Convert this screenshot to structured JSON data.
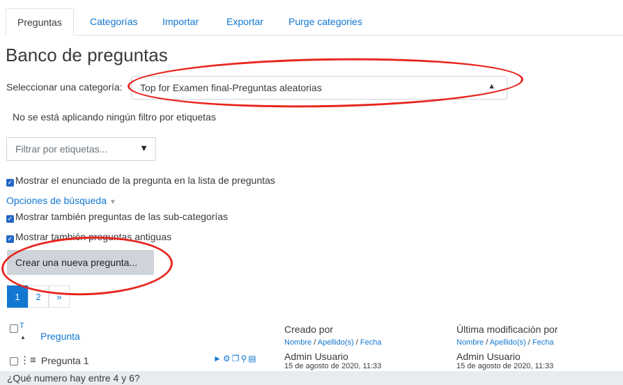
{
  "tabs": [
    "Preguntas",
    "Categorías",
    "Importar",
    "Exportar",
    "Purge categories"
  ],
  "page_title": "Banco de preguntas",
  "category": {
    "label": "Seleccionar una categoría:",
    "selected": "Top for Examen final-Preguntas aleatorias"
  },
  "filter_status": "No se está aplicando ningún filtro por etiquetas",
  "tag_filter": {
    "placeholder": "Filtrar por etiquetas...",
    "arrow": "▼"
  },
  "checkboxes": {
    "show_text": "Mostrar el enunciado de la pregunta en la lista de preguntas",
    "subcategories": "Mostrar también preguntas de las sub-categorías",
    "old": "Mostrar también preguntas antiguas"
  },
  "search_options": "Opciones de búsqueda",
  "new_question_button": "Crear una nueva pregunta...",
  "pagination": {
    "pages": [
      "1",
      "2"
    ],
    "next": "»",
    "current": "1"
  },
  "table": {
    "sort_type_label": "T",
    "col_question": "Pregunta",
    "col_created": "Creado por",
    "col_modified": "Última modificación por",
    "sub_name": "Nombre",
    "sub_surname": "Apellido(s)",
    "sub_date": "Fecha",
    "sub_sep": "/",
    "rows": [
      {
        "name": "Pregunta 1",
        "created_by": "Admin Usuario",
        "created_date": "15 de agosto de 2020, 11:33",
        "modified_by": "Admin Usuario",
        "modified_date": "15 de agosto de 2020, 11:33",
        "text": "¿Qué numero hay entre 4 y 6?"
      }
    ]
  },
  "colors": {
    "link": "#1177d1",
    "annotation": "#e8251e",
    "button": "#ced4da"
  }
}
